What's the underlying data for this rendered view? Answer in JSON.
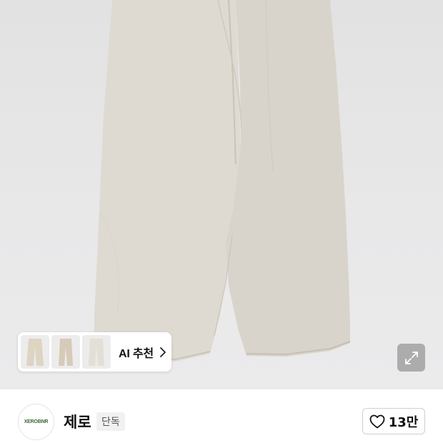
{
  "product": {
    "image_alt": "",
    "ai_recommend": {
      "label": "AI 추천",
      "thumbnails": [
        "beige-pants-thumb",
        "beige-trousers-thumb",
        "ivory-pants-thumb"
      ]
    },
    "expand_icon": "expand-arrows-icon"
  },
  "brand": {
    "logo_text": "XEROBNR",
    "name": "제로",
    "badge": "단독",
    "like_count": "13만"
  },
  "colors": {
    "pants": "#dedad2",
    "background": "#e6e6e7",
    "logo_green": "#3b6b32"
  }
}
